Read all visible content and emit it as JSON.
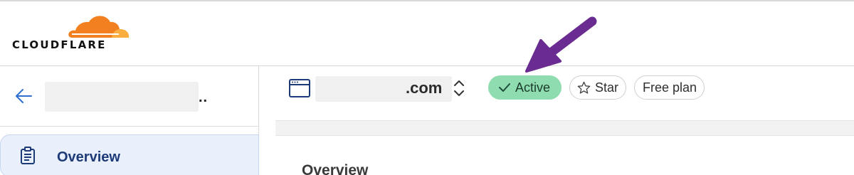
{
  "brand": {
    "wordmark": "CLOUDFLARE",
    "cloud_color": "#f38020",
    "cloud_light_color": "#faae40"
  },
  "sidebar": {
    "back_icon": "arrow-left-icon",
    "account_ellipsis": "..",
    "nav": [
      {
        "label": "Overview",
        "icon": "clipboard-icon",
        "selected": true
      }
    ]
  },
  "zone": {
    "icon": "browser-window-icon",
    "domain_suffix": ".com",
    "switcher_icon": "chevron-up-down-icon",
    "status": {
      "label": "Active",
      "icon": "check-icon",
      "color": "#8fdcb0"
    },
    "star": {
      "label": "Star",
      "icon": "star-outline-icon"
    },
    "plan": {
      "label": "Free plan"
    }
  },
  "main": {
    "heading": "Overview"
  },
  "annotation": {
    "arrow_color": "#6a2c91"
  }
}
